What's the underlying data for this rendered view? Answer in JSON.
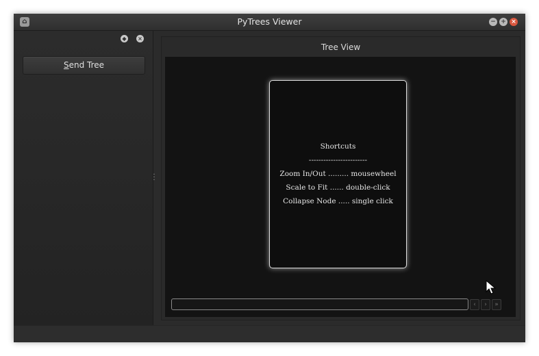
{
  "window": {
    "title": "PyTrees Viewer",
    "icons": {
      "app": "app-icon",
      "minimize": "minimize-icon",
      "maximize": "maximize-icon",
      "close": "close-icon"
    }
  },
  "dock": {
    "icons": {
      "float": "float-icon",
      "close": "close-icon"
    },
    "send_button": {
      "mnemonic": "S",
      "rest": "end Tree"
    }
  },
  "tree_view": {
    "title": "Tree View",
    "help": {
      "heading": "Shortcuts",
      "separator": "------------------------",
      "lines": [
        "Zoom In/Out ......... mousewheel",
        "Scale to Fit ...... double-click",
        "Collapse Node ..... single click"
      ]
    },
    "nav": {
      "prev": "‹",
      "next": "›",
      "last": "»"
    }
  }
}
